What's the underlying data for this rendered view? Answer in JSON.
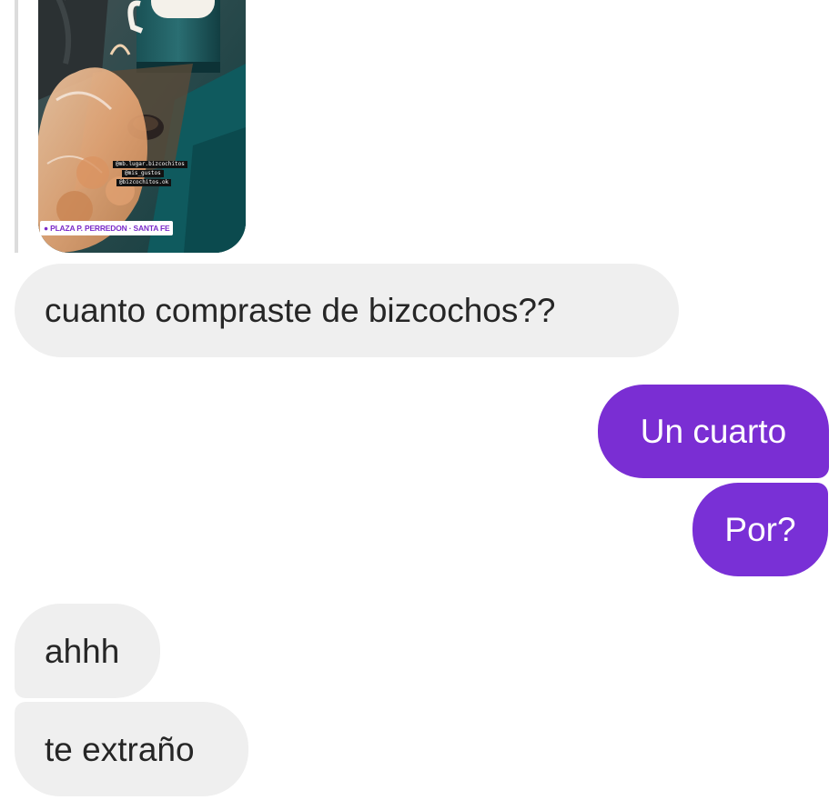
{
  "story_reply": {
    "location_sticker": "● PLAZA P. PERREDON · SANTA FE",
    "sticker_lines": [
      "@mb.lugar.bizcochitos",
      "@mis_gustos",
      "@bizcochitos.ok"
    ]
  },
  "messages": [
    {
      "direction": "received",
      "text": "cuanto compraste de bizcochos??"
    },
    {
      "direction": "sent",
      "text": "Un cuarto"
    },
    {
      "direction": "sent",
      "text": "Por?"
    },
    {
      "direction": "received",
      "text": "ahhh"
    },
    {
      "direction": "received",
      "text": "te extraño"
    }
  ],
  "colors": {
    "sent_bubble": "#7a2ed3",
    "received_bubble": "#efefef",
    "received_text": "#262626",
    "sent_text": "#ffffff"
  }
}
